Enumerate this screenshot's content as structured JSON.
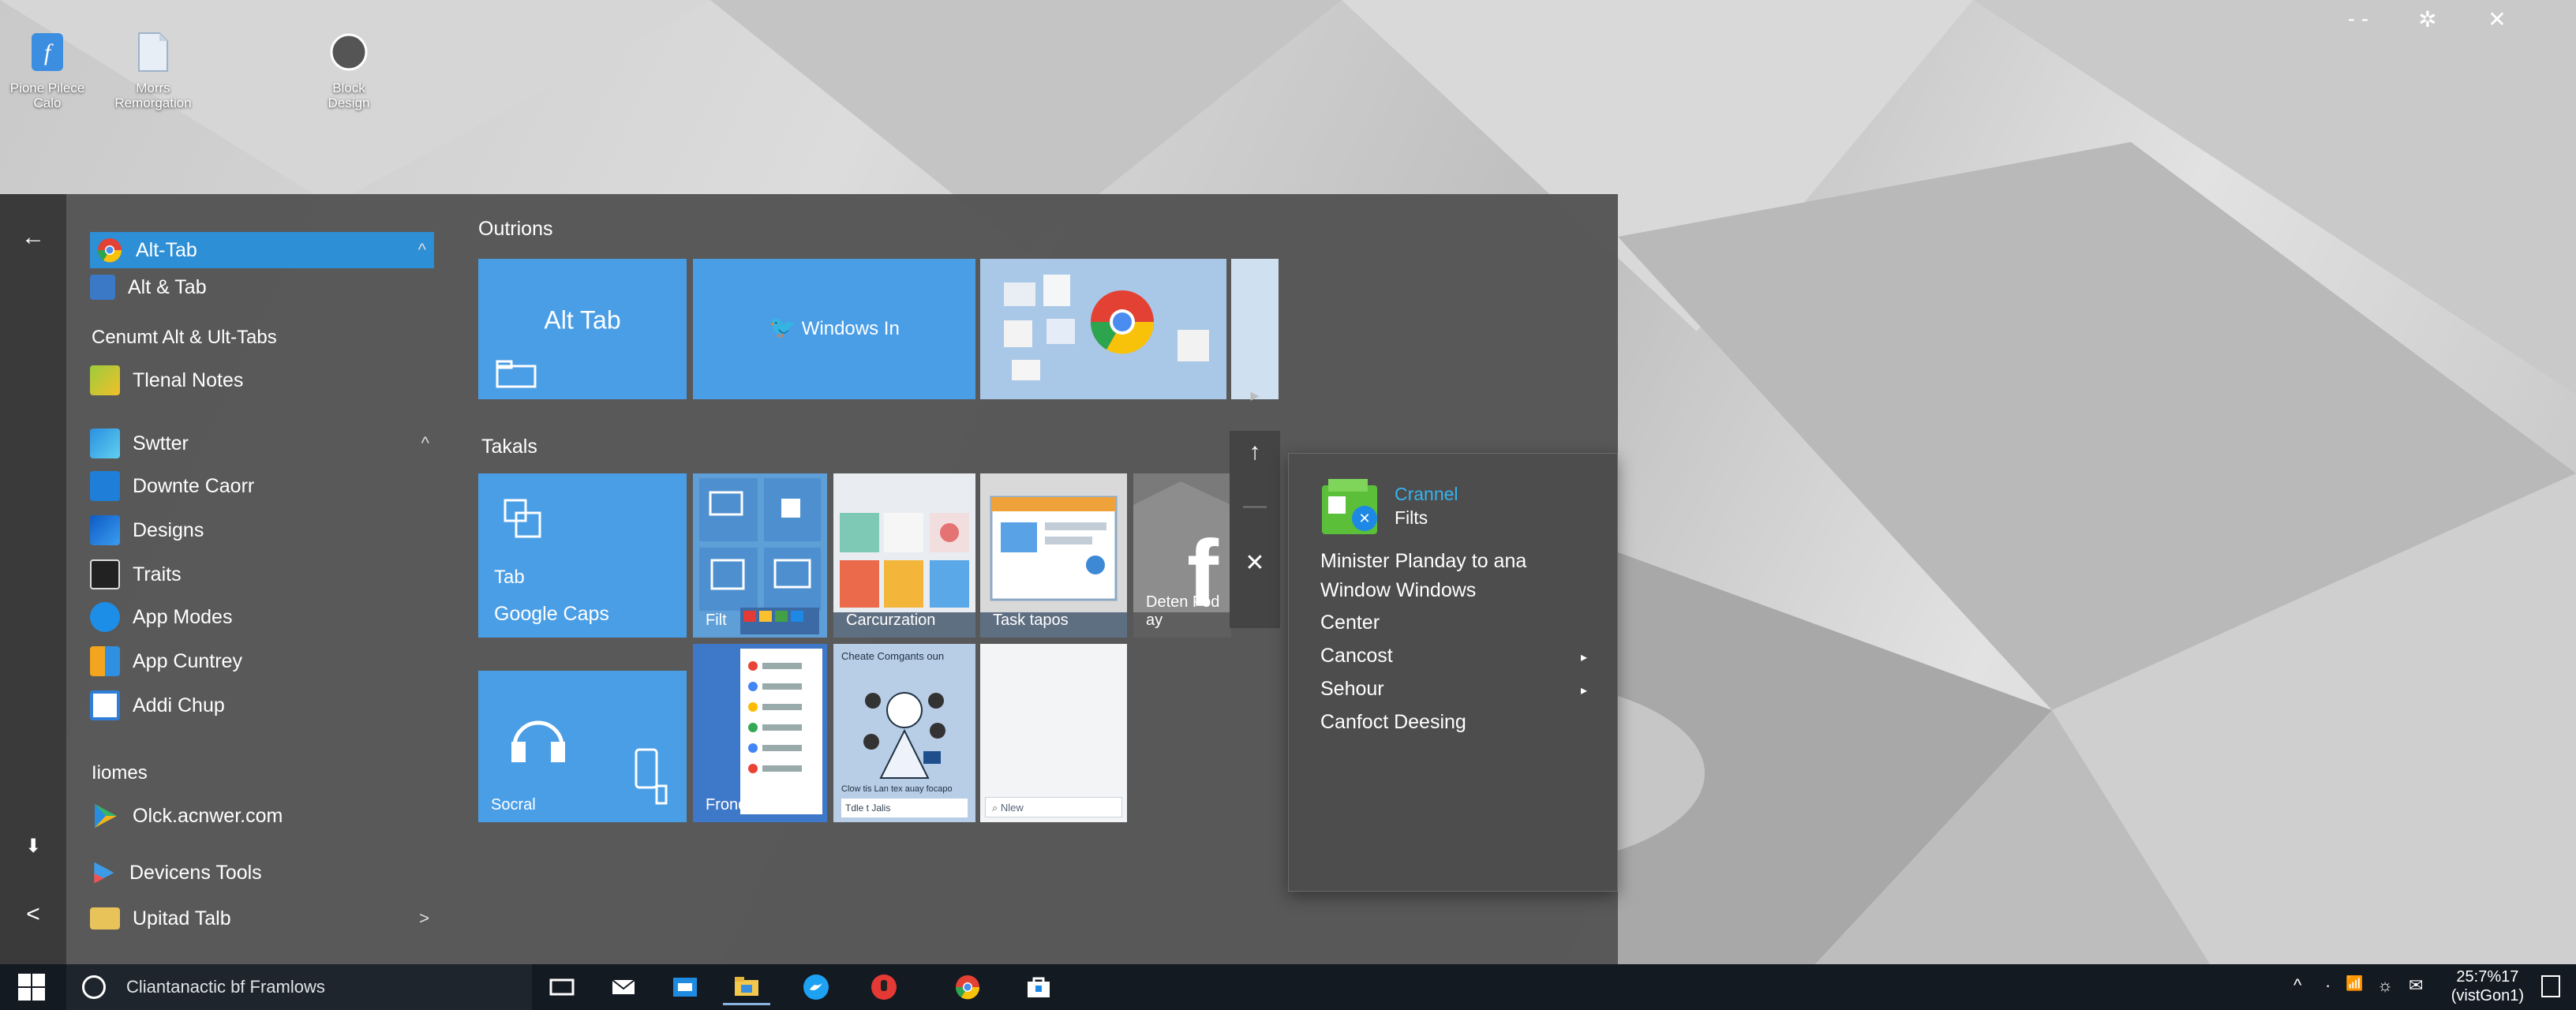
{
  "desktop": {
    "icons": [
      {
        "label_line1": "Pione Pilece",
        "label_line2": "Calo",
        "icon": "app-f-icon"
      },
      {
        "label_line1": "Morrs",
        "label_line2": "Remorgation",
        "icon": "document-icon"
      },
      {
        "label_line1": "Block",
        "label_line2": "Design",
        "icon": "compass-icon"
      }
    ],
    "window_controls": {
      "minimize": "- -",
      "settings": "✲",
      "close": "✕"
    }
  },
  "start_menu": {
    "rail": {
      "back": "←",
      "download": "⬇",
      "share": "<"
    },
    "app_list": {
      "selected": {
        "label": "Alt-Tab",
        "chevron": "^"
      },
      "items_top": [
        {
          "label": "Alt & Tab",
          "icon": "alt-tab-icon"
        }
      ],
      "section_recent": "Cenumt Alt & Ult-Tabs",
      "recent": [
        {
          "label": "Tlenal Notes",
          "icon": "notes-icon"
        }
      ],
      "group": [
        {
          "label": "Swtter",
          "icon": "switch-icon",
          "chevron": "^"
        },
        {
          "label": "Downte Caorr",
          "icon": "download-icon"
        },
        {
          "label": "Designs",
          "icon": "designs-icon"
        },
        {
          "label": "Traits",
          "icon": "traits-icon"
        },
        {
          "label": "App Modes",
          "icon": "modes-icon"
        },
        {
          "label": "App Cuntrey",
          "icon": "country-icon"
        },
        {
          "label": "Addi Chup",
          "icon": "chip-icon"
        }
      ],
      "section_homes": "Iiomes",
      "homes": [
        {
          "label": "Olck.acnwer.com",
          "icon": "play-icon"
        },
        {
          "label": "Devicens Tools",
          "icon": "devices-icon"
        },
        {
          "label": "Upitad Talb",
          "icon": "folder-icon",
          "chevron": ">"
        }
      ]
    },
    "tiles": {
      "group1_title": "Outrions",
      "group2_title": "Takals",
      "alt_tab": "Alt Tab",
      "windows_in": "Windows In",
      "tab_line1": "Tab",
      "tab_line2": "Google Caps",
      "filt": "Filt",
      "carcuration": "Carcurzation",
      "task_taps": "Task tapos",
      "deten_fod": "Deten Fod ay",
      "socral": "Socral",
      "fronds": "Fronds",
      "chat_title": "Cheate Comgants oun",
      "chat_sub": "Clow tis Lan tex auay focapo",
      "chat_input": "Tdle t Jalis",
      "search_placeholder": "Nlew"
    },
    "side_buttons": {
      "next": "▸",
      "up": "↑",
      "dash": "—",
      "close": "✕"
    },
    "context_menu": {
      "header_title": "Crannel",
      "header_sub": "Filts",
      "item1_line1": "Minister Planday to ana",
      "item1_line2": "Window Windows",
      "items": [
        {
          "label": "Center",
          "arrow": ""
        },
        {
          "label": "Cancost",
          "arrow": "▸"
        },
        {
          "label": "Sehour",
          "arrow": "▸"
        },
        {
          "label": "Canfoct Deesing",
          "arrow": ""
        }
      ]
    }
  },
  "taskbar": {
    "search_text": "Cliantanactic bf Framlows",
    "clock_time": "25:7%17",
    "clock_date": "(vistGon1)",
    "tray": [
      "^",
      "·",
      "📶",
      "☼",
      "✉"
    ]
  },
  "colors": {
    "accent": "#2d8fd5",
    "tile_blue": "#4a9ee6",
    "menu_bg": "#535353",
    "taskbar_bg": "#141a22"
  }
}
